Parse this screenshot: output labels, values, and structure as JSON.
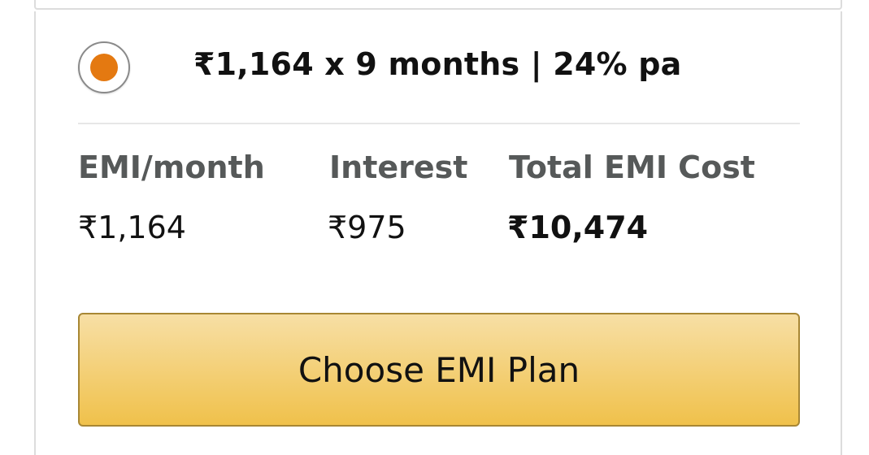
{
  "plan": {
    "label": "₹1,164 x 9 months | 24% pa",
    "selected": true
  },
  "columns": {
    "emi": {
      "header": "EMI/month",
      "value": "₹1,164"
    },
    "interest": {
      "header": "Interest",
      "value": "₹975"
    },
    "total": {
      "header": "Total EMI Cost",
      "value": "₹10,474"
    }
  },
  "cta": {
    "label": "Choose EMI Plan"
  },
  "colors": {
    "accent": "#e47911",
    "button_top": "#f7dfa5",
    "button_bottom": "#f0c14b",
    "button_border": "#a88734",
    "header_text": "#565959"
  }
}
